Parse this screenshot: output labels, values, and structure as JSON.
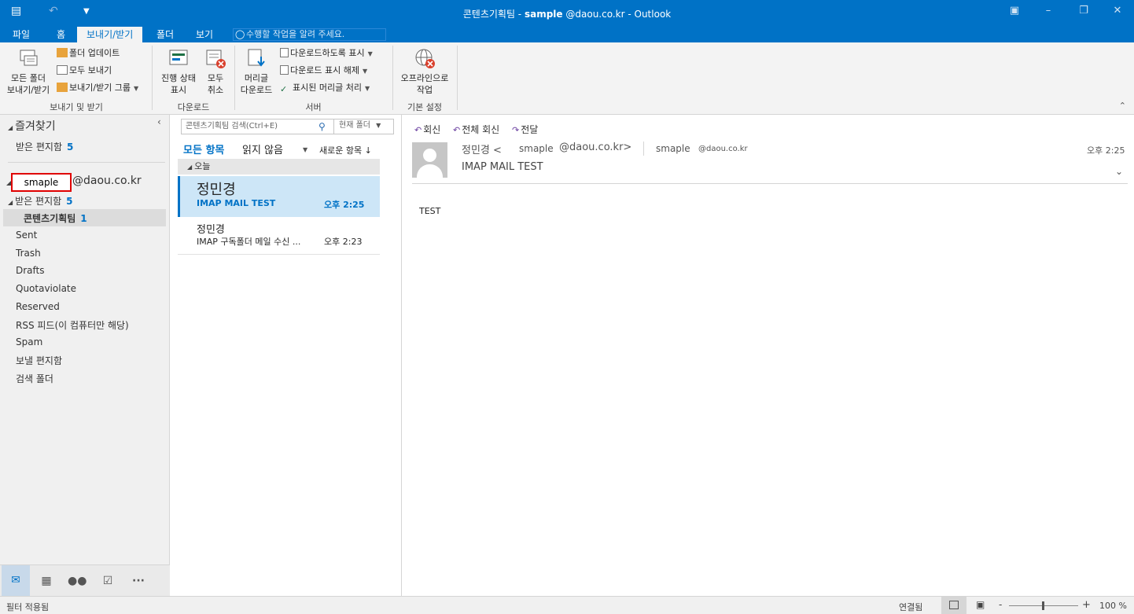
{
  "window": {
    "title_folder": "콘텐츠기획팀 -",
    "title_account": "sample",
    "title_suffix": "@daou.co.kr - Outlook"
  },
  "tabs": [
    "파일",
    "홈",
    "보내기/받기",
    "폴더",
    "보기"
  ],
  "tell_me_placeholder": "수행할 작업을 알려 주세요.",
  "ribbon": {
    "send_receive": {
      "all_folders": [
        "모든 폴더",
        "보내기/받기"
      ],
      "update_folder": "폴더 업데이트",
      "send_all": "모두 보내기",
      "groups": "보내기/받기 그룹",
      "label": "보내기 및 받기"
    },
    "download": {
      "show_progress": [
        "진행 상태",
        "표시"
      ],
      "cancel_all": [
        "모두",
        "취소"
      ],
      "label": "다운로드"
    },
    "server": {
      "download_headers": [
        "머리글",
        "다운로드"
      ],
      "mark_download": "다운로드하도록 표시",
      "unmark_download": "다운로드 표시 해제",
      "process_marked": "표시된 머리글 처리",
      "label": "서버"
    },
    "preferences": {
      "work_offline": [
        "오프라인으로",
        "작업"
      ],
      "label": "기본 설정"
    }
  },
  "folder_pane": {
    "favorites": "즐겨찾기",
    "favorites_inbox": "받은 편지함",
    "favorites_inbox_count": "5",
    "account_user": "smaple",
    "account_domain": "@daou.co.kr",
    "inbox": "받은 편지함",
    "inbox_count": "5",
    "selected_folder": "콘텐츠기획팀",
    "selected_folder_count": "1",
    "folders": [
      "Sent",
      "Trash",
      "Drafts",
      "Quotaviolate",
      "Reserved",
      "RSS 피드(이 컴퓨터만 해당)",
      "Spam",
      "보낼 편지함",
      "검색 폴더"
    ]
  },
  "message_list": {
    "search_placeholder": "콘텐츠기획팀 검색(Ctrl+E)",
    "search_scope": "현재 폴더",
    "filter_all": "모든 항목",
    "filter_unread": "읽지 않음",
    "sort": "새로운 항목 ↓",
    "group_today": "오늘",
    "messages": [
      {
        "from": "정민경",
        "subject": "IMAP MAIL TEST",
        "time": "오후 2:25"
      },
      {
        "from": "정민경",
        "subject": "IMAP 구독폴더 메일 수신 ...",
        "time": "오후 2:23"
      }
    ]
  },
  "reading_pane": {
    "reply": "회신",
    "reply_all": "전체 회신",
    "forward": "전달",
    "sender_name": "정민경 <",
    "sender_user": "smaple",
    "sender_domain": "@daou.co.kr>",
    "to_user": "smaple",
    "to_domain": "@daou.co.kr",
    "time": "오후 2:25",
    "subject": "IMAP MAIL TEST",
    "body": "TEST"
  },
  "status_bar": {
    "filter": "필터 적용됨",
    "connection": "연결됨",
    "zoom": "100 %",
    "zoom_level": 1.0
  },
  "colors": {
    "accent": "#0072c6",
    "highlight_border": "#e00000"
  }
}
